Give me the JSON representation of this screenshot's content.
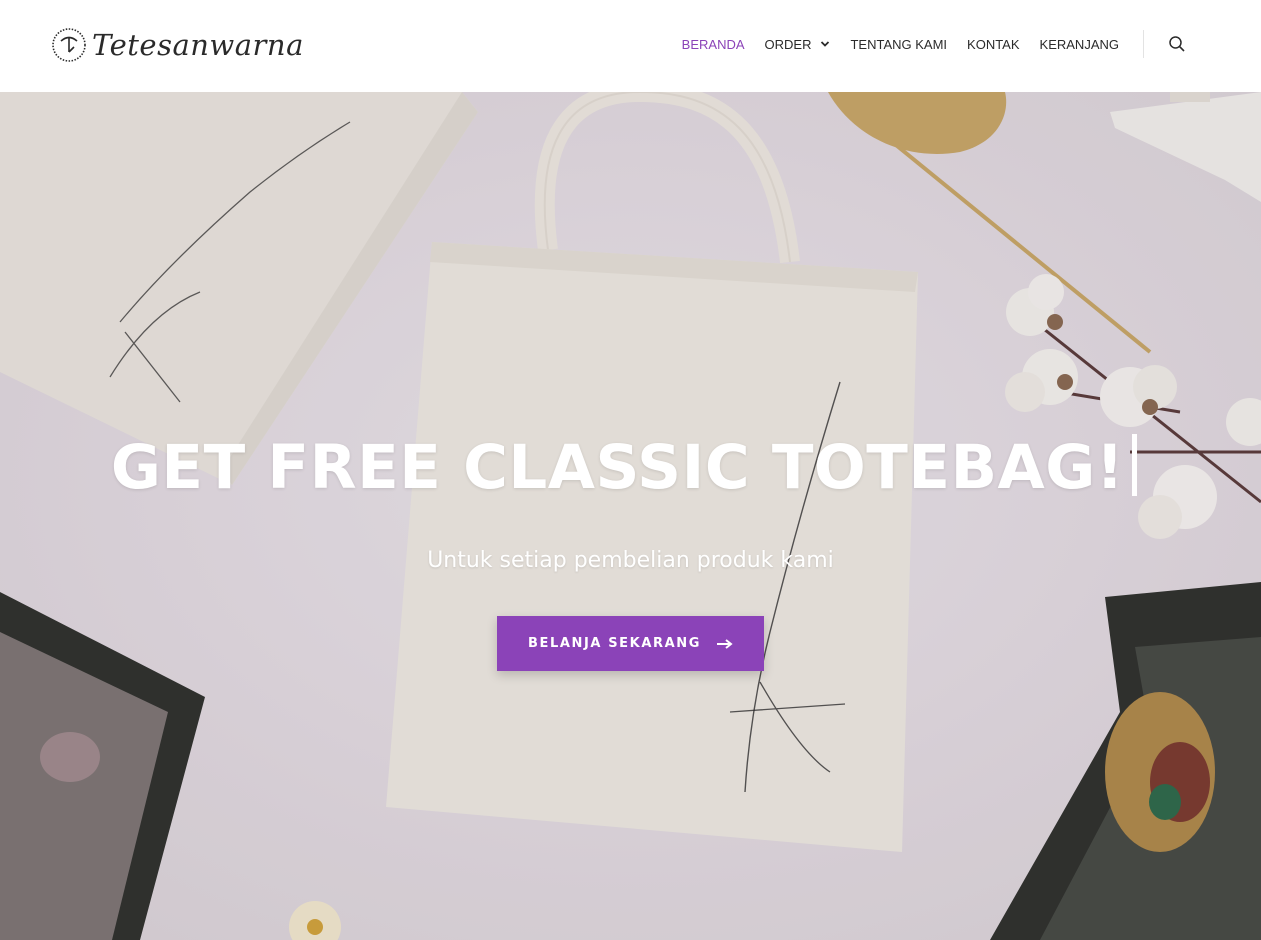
{
  "header": {
    "logo_text": "Tetesanwarna",
    "nav": [
      {
        "label": "BERANDA",
        "active": true
      },
      {
        "label": "ORDER",
        "has_dropdown": true
      },
      {
        "label": "TENTANG KAMI"
      },
      {
        "label": "KONTAK"
      },
      {
        "label": "KERANJANG"
      }
    ],
    "search_icon": "search-icon"
  },
  "hero": {
    "title": "GET FREE CLASSIC TOTEBAG!",
    "subtitle": "Untuk setiap pembelian produk kami",
    "cta_label": "BELANJA SEKARANG",
    "cta_icon": "arrow-right-icon"
  },
  "colors": {
    "accent": "#8b43b8",
    "nav_text": "#2b2b2b",
    "hero_text": "#ffffff"
  }
}
